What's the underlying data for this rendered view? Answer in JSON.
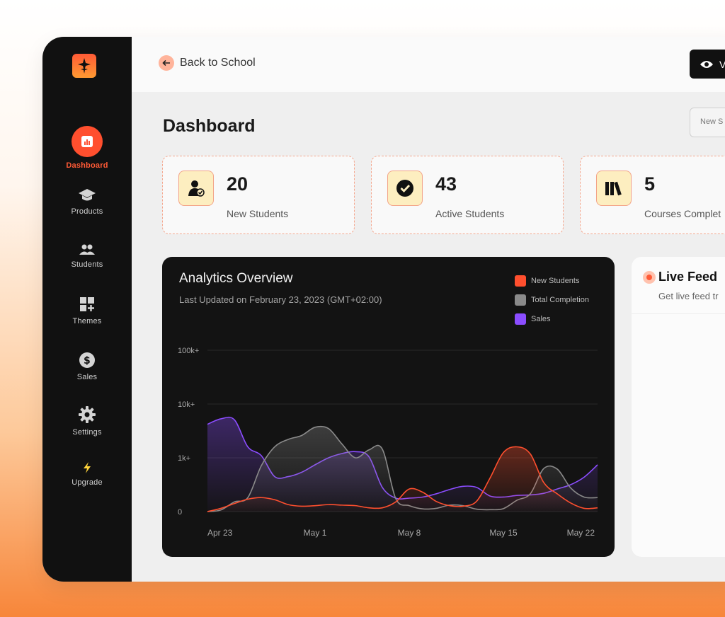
{
  "colors": {
    "accent": "#ff4f2e",
    "new_students": "#ff4f2e",
    "total_completion": "#8a8a8a",
    "sales": "#8b4dff"
  },
  "sidebar": {
    "items": [
      {
        "label": "Dashboard",
        "icon": "bar-chart-icon",
        "active": true
      },
      {
        "label": "Products",
        "icon": "graduation-cap-icon"
      },
      {
        "label": "Students",
        "icon": "users-icon"
      },
      {
        "label": "Themes",
        "icon": "grid-plus-icon"
      },
      {
        "label": "Sales",
        "icon": "dollar-icon"
      },
      {
        "label": "Settings",
        "icon": "gear-icon"
      },
      {
        "label": "Upgrade",
        "icon": "lightning-icon"
      }
    ]
  },
  "topbar": {
    "back_label": "Back to School",
    "view_label": "V"
  },
  "page": {
    "title": "Dashboard",
    "new_select": "New S"
  },
  "stats": [
    {
      "value": "20",
      "label": "New Students",
      "icon": "user-check-icon"
    },
    {
      "value": "43",
      "label": "Active Students",
      "icon": "check-circle-icon"
    },
    {
      "value": "5",
      "label": "Courses Complet",
      "icon": "books-icon"
    }
  ],
  "analytics": {
    "title": "Analytics Overview",
    "updated": "Last Updated on February 23, 2023 (GMT+02:00)"
  },
  "chart_data": {
    "type": "area",
    "x": [
      "Apr 23",
      "Apr 24",
      "Apr 25",
      "Apr 26",
      "Apr 27",
      "Apr 28",
      "Apr 29",
      "Apr 30",
      "May 1",
      "May 2",
      "May 3",
      "May 4",
      "May 5",
      "May 6",
      "May 7",
      "May 8",
      "May 9",
      "May 10",
      "May 11",
      "May 12",
      "May 13",
      "May 14",
      "May 15",
      "May 16",
      "May 17",
      "May 18",
      "May 19",
      "May 20",
      "May 21",
      "May 22"
    ],
    "x_ticks": [
      "Apr 23",
      "May 1",
      "May 8",
      "May 15",
      "May 22"
    ],
    "y_ticks": [
      "0",
      "1k+",
      "10k+",
      "100k+"
    ],
    "y_scale": "log",
    "ylim": [
      0,
      100000
    ],
    "series": [
      {
        "name": "New Students",
        "values": [
          0,
          60,
          150,
          230,
          260,
          220,
          130,
          100,
          110,
          130,
          120,
          110,
          70,
          70,
          180,
          420,
          360,
          190,
          110,
          100,
          190,
          620,
          1250,
          1600,
          1180,
          540,
          330,
          160,
          60,
          70
        ]
      },
      {
        "name": "Total Completion",
        "values": [
          0,
          30,
          180,
          260,
          850,
          1600,
          2200,
          2600,
          3700,
          3500,
          1800,
          1000,
          1400,
          1450,
          240,
          110,
          50,
          60,
          120,
          110,
          45,
          35,
          55,
          210,
          330,
          800,
          790,
          440,
          270,
          260
        ]
      },
      {
        "name": "Sales",
        "values": [
          4200,
          5300,
          5100,
          1600,
          1100,
          650,
          650,
          730,
          870,
          1000,
          1200,
          1300,
          1050,
          450,
          250,
          250,
          270,
          330,
          410,
          470,
          450,
          290,
          270,
          300,
          310,
          340,
          420,
          500,
          640,
          870
        ]
      }
    ]
  },
  "feed": {
    "title": "Live Feed",
    "subtitle": "Get live feed tr"
  }
}
